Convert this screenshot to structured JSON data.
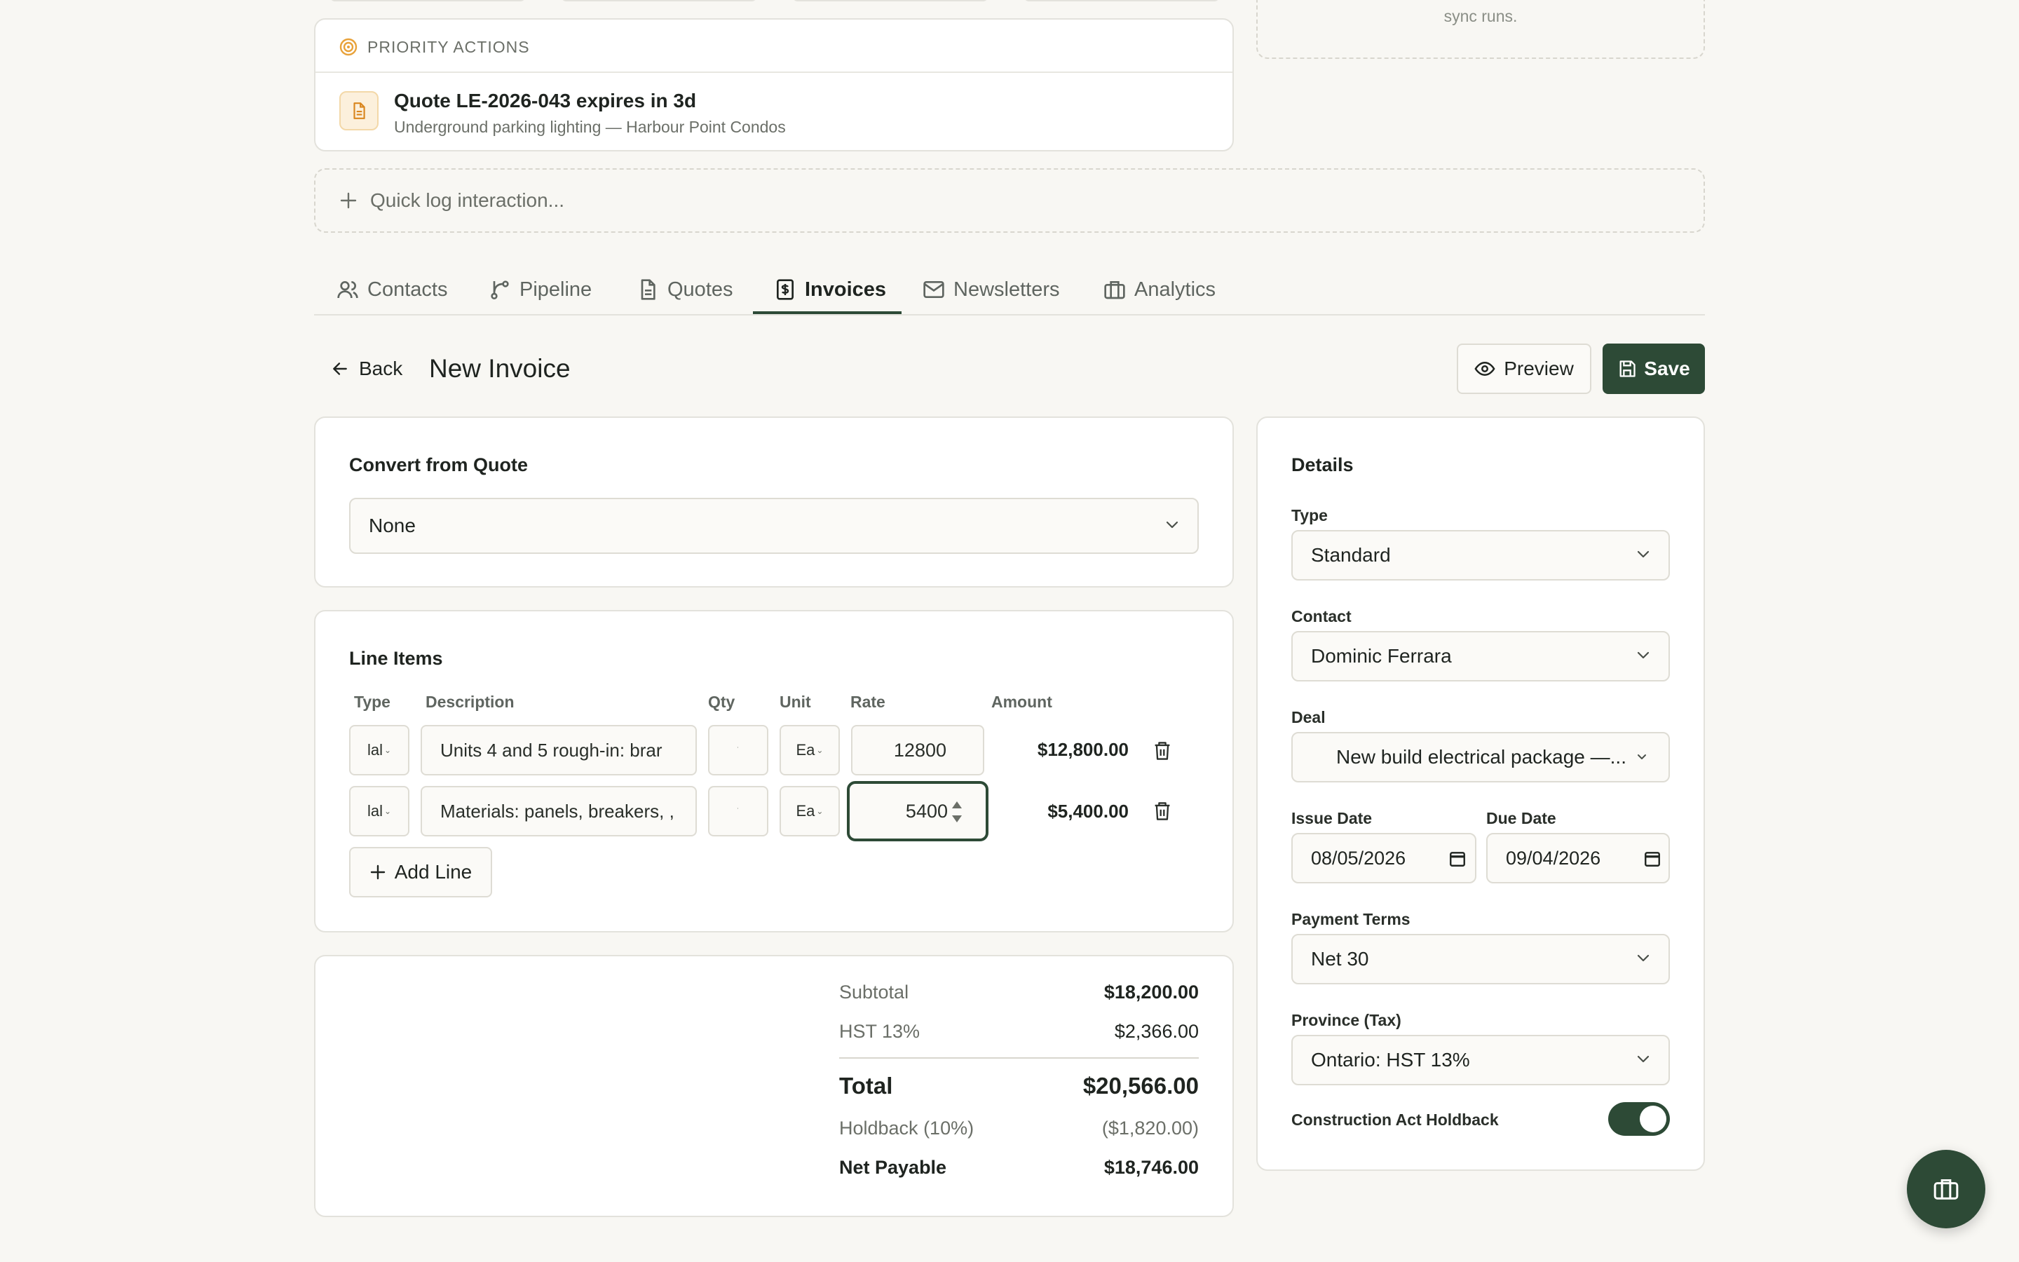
{
  "priority": {
    "header": "PRIORITY ACTIONS",
    "item_title": "Quote LE-2026-043 expires in 3d",
    "item_subtitle": "Underground parking lighting — Harbour Point Condos"
  },
  "sync_note": "sync runs.",
  "quick_log": "Quick log interaction...",
  "tabs": [
    {
      "label": "Contacts",
      "icon": "contacts-icon"
    },
    {
      "label": "Pipeline",
      "icon": "pipeline-icon"
    },
    {
      "label": "Quotes",
      "icon": "quote-icon"
    },
    {
      "label": "Invoices",
      "icon": "invoice-icon",
      "active": true
    },
    {
      "label": "Newsletters",
      "icon": "mail-icon"
    },
    {
      "label": "Analytics",
      "icon": "analytics-icon"
    }
  ],
  "header": {
    "back_label": "Back",
    "title": "New Invoice",
    "preview_label": "Preview",
    "save_label": "Save"
  },
  "convert": {
    "title": "Convert from Quote",
    "selected": "None"
  },
  "line_items": {
    "title": "Line Items",
    "columns": [
      "Type",
      "Description",
      "Qty",
      "Unit",
      "Rate",
      "Amount"
    ],
    "rows": [
      {
        "type": "lal",
        "description": "Units 4 and 5 rough-in: brar",
        "qty": "",
        "unit": "Ea",
        "rate": "12800",
        "amount": "$12,800.00"
      },
      {
        "type": "lal",
        "description": "Materials: panels, breakers, ,",
        "qty": "",
        "unit": "Ea",
        "rate": "5400",
        "amount": "$5,400.00"
      }
    ],
    "add_line_label": "Add Line"
  },
  "totals": {
    "subtotal_label": "Subtotal",
    "subtotal": "$18,200.00",
    "tax_label": "HST 13%",
    "tax": "$2,366.00",
    "total_label": "Total",
    "total": "$20,566.00",
    "holdback_label": "Holdback (10%)",
    "holdback": "($1,820.00)",
    "net_label": "Net Payable",
    "net": "$18,746.00"
  },
  "details": {
    "title": "Details",
    "type_label": "Type",
    "type_value": "Standard",
    "contact_label": "Contact",
    "contact_value": "Dominic Ferrara",
    "deal_label": "Deal",
    "deal_value": "New build electrical package —...",
    "issue_label": "Issue Date",
    "issue_value": "08/05/2026",
    "due_label": "Due Date",
    "due_value": "09/04/2026",
    "terms_label": "Payment Terms",
    "terms_value": "Net 30",
    "province_label": "Province (Tax)",
    "province_value": "Ontario: HST 13%",
    "holdback_label": "Construction Act Holdback",
    "holdback_on": true
  },
  "colors": {
    "accent": "#2d4a36",
    "priority_icon": "#e8a23a",
    "background": "#f8f7f3"
  }
}
